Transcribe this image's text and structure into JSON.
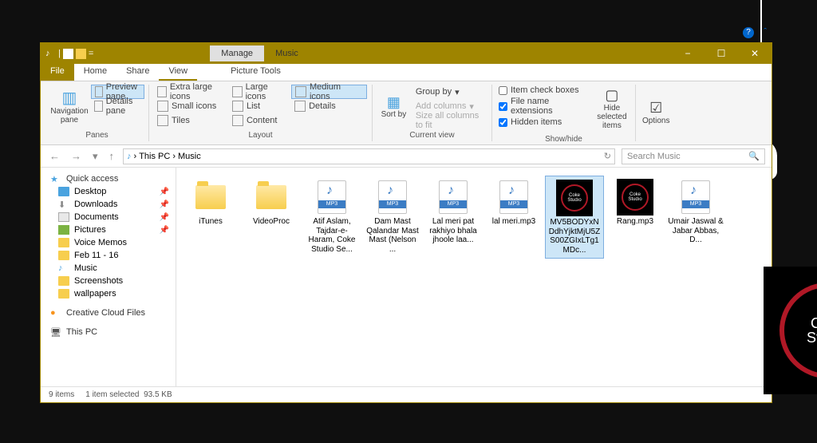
{
  "titlebar": {
    "manage": "Manage",
    "music": "Music"
  },
  "tabs": {
    "file": "File",
    "home": "Home",
    "share": "Share",
    "view": "View",
    "picture_tools": "Picture Tools"
  },
  "ribbon": {
    "panes": {
      "nav": "Navigation pane",
      "preview": "Preview pane",
      "details": "Details pane",
      "label": "Panes"
    },
    "layout": {
      "xl": "Extra large icons",
      "lg": "Large icons",
      "md": "Medium icons",
      "sm": "Small icons",
      "list": "List",
      "content": "Content",
      "tiles": "Tiles",
      "details": "Details",
      "label": "Layout"
    },
    "current": {
      "sort": "Sort by",
      "group": "Group by",
      "addcol": "Add columns",
      "size": "Size all columns to fit",
      "label": "Current view"
    },
    "showhide": {
      "check": "Item check boxes",
      "ext": "File name extensions",
      "hidden": "Hidden items",
      "hide": "Hide selected items",
      "label": "Show/hide"
    },
    "options": "Options"
  },
  "breadcrumb": {
    "pc": "This PC",
    "music": "Music"
  },
  "search": {
    "placeholder": "Search Music"
  },
  "sidebar": {
    "quick": "Quick access",
    "items": [
      {
        "label": "Desktop",
        "pin": true,
        "ico": "desktop"
      },
      {
        "label": "Downloads",
        "pin": true,
        "ico": "dl"
      },
      {
        "label": "Documents",
        "pin": true,
        "ico": "doc"
      },
      {
        "label": "Pictures",
        "pin": true,
        "ico": "pic"
      },
      {
        "label": "Voice Memos",
        "pin": false,
        "ico": "fold"
      },
      {
        "label": "Feb 11 - 16",
        "pin": false,
        "ico": "fold"
      },
      {
        "label": "Music",
        "pin": false,
        "ico": "music"
      },
      {
        "label": "Screenshots",
        "pin": false,
        "ico": "fold"
      },
      {
        "label": "wallpapers",
        "pin": false,
        "ico": "fold"
      }
    ],
    "creative": "Creative Cloud Files",
    "thispc": "This PC"
  },
  "files": [
    {
      "name": "iTunes",
      "type": "folder"
    },
    {
      "name": "VideoProc",
      "type": "folder"
    },
    {
      "name": "Atif Aslam, Tajdar-e-Haram, Coke Studio Se...",
      "type": "mp3"
    },
    {
      "name": "Dam Mast Qalandar Mast Mast (Nelson ...",
      "type": "mp3"
    },
    {
      "name": "Lal meri pat rakhiyo bhala jhoole laa...",
      "type": "mp3"
    },
    {
      "name": "lal meri.mp3",
      "type": "mp3"
    },
    {
      "name": "MV5BODYxNDdhYjktMjU5ZS00ZGIxLTg1MDc...",
      "type": "image",
      "selected": true
    },
    {
      "name": "Rang.mp3",
      "type": "image"
    },
    {
      "name": "Umair Jaswal & Jabar Abbas, D...",
      "type": "mp3"
    }
  ],
  "status": {
    "count": "9 items",
    "sel": "1 item selected",
    "size": "93.5 KB"
  }
}
